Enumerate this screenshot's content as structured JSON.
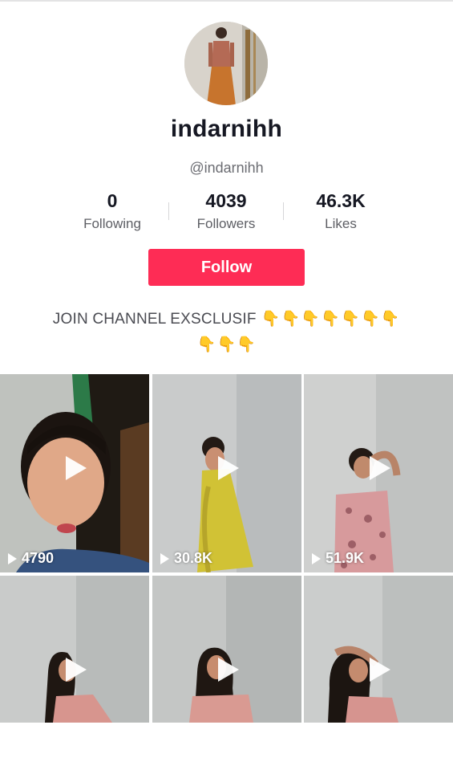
{
  "profile": {
    "display_name": "indarnihh",
    "handle": "@indarnihh",
    "avatar_icon": "profile-photo"
  },
  "stats": [
    {
      "value": "0",
      "label": "Following"
    },
    {
      "value": "4039",
      "label": "Followers"
    },
    {
      "value": "46.3K",
      "label": "Likes"
    }
  ],
  "follow_button": {
    "label": "Follow",
    "color": "#fe2c55"
  },
  "bio": {
    "text": "JOIN CHANNEL EXSCLUSIF",
    "emoji": "👇",
    "emoji_count": 10
  },
  "videos": [
    {
      "views": "4790"
    },
    {
      "views": "30.8K"
    },
    {
      "views": "51.9K"
    },
    {
      "views": ""
    },
    {
      "views": ""
    },
    {
      "views": ""
    }
  ],
  "icons": {
    "play": "play-icon",
    "views": "play-count-icon"
  }
}
